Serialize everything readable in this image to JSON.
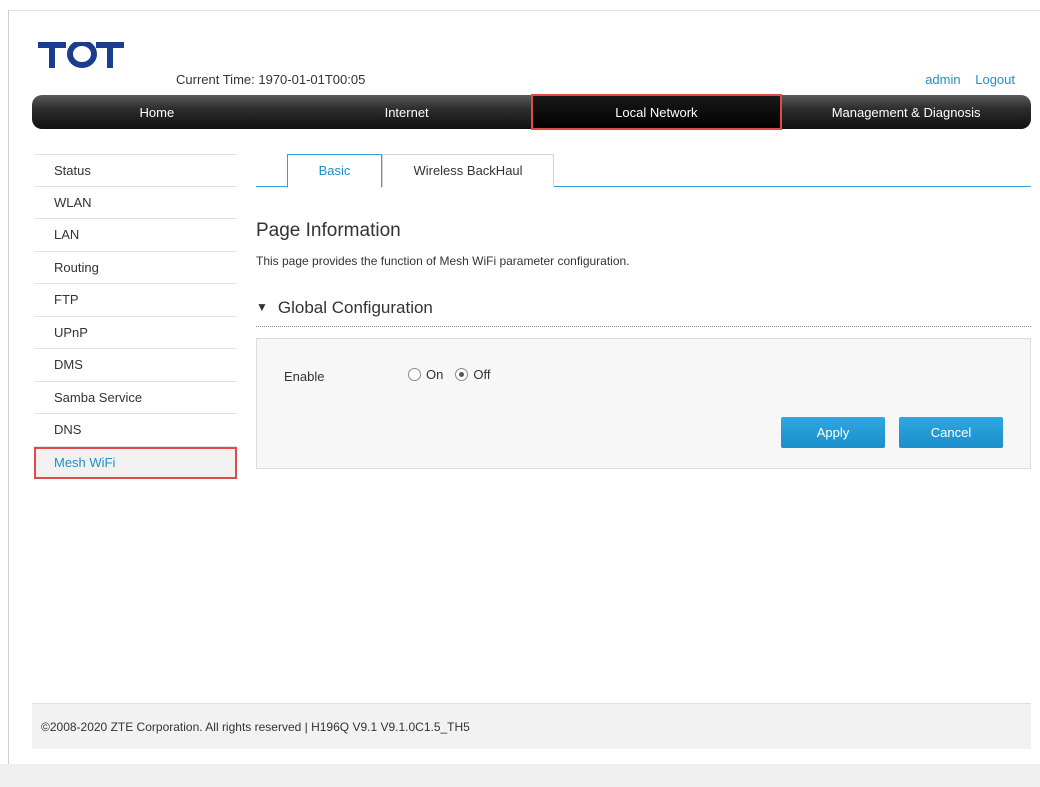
{
  "header": {
    "logo_text": "TOT",
    "current_time_label": "Current Time: 1970-01-01T00:05",
    "user_link": "admin",
    "logout_link": "Logout"
  },
  "nav": {
    "items": [
      {
        "label": "Home"
      },
      {
        "label": "Internet"
      },
      {
        "label": "Local Network"
      },
      {
        "label": "Management & Diagnosis"
      }
    ],
    "active": "Local Network"
  },
  "sidebar": {
    "items": [
      {
        "label": "Status"
      },
      {
        "label": "WLAN"
      },
      {
        "label": "LAN"
      },
      {
        "label": "Routing"
      },
      {
        "label": "FTP"
      },
      {
        "label": "UPnP"
      },
      {
        "label": "DMS"
      },
      {
        "label": "Samba Service"
      },
      {
        "label": "DNS"
      },
      {
        "label": "Mesh WiFi"
      }
    ],
    "active": "Mesh WiFi"
  },
  "tabs": {
    "basic": "Basic",
    "backhaul": "Wireless BackHaul"
  },
  "page": {
    "title": "Page Information",
    "description": "This page provides the function of Mesh WiFi parameter configuration."
  },
  "global_config": {
    "title": "Global Configuration",
    "enable_label": "Enable",
    "on_label": "On",
    "off_label": "Off",
    "selected": "Off",
    "apply_label": "Apply",
    "cancel_label": "Cancel"
  },
  "footer": {
    "text": "©2008-2020 ZTE Corporation. All rights reserved  |   H196Q V9.1 V9.1.0C1.5_TH5"
  },
  "colors": {
    "accent": "#1e8fc8",
    "highlight": "#e04a4a"
  }
}
